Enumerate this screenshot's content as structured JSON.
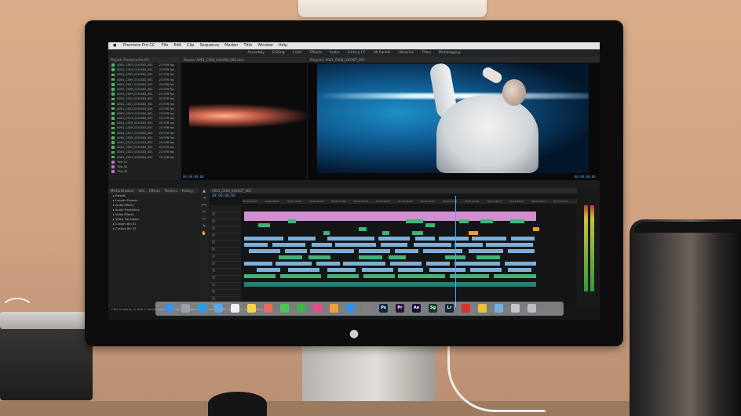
{
  "menubar": {
    "app_title": "Premiere Pro CC",
    "items": [
      "File",
      "Edit",
      "Clip",
      "Sequence",
      "Marker",
      "Title",
      "Window",
      "Help"
    ]
  },
  "workspaces": [
    "Assembly",
    "Editing",
    "Color",
    "Effects",
    "Audio",
    "Editing CC",
    "All Panels",
    "Libraries",
    "Titles",
    "Metalogging"
  ],
  "panels": {
    "project_title": "Project: Premiere Pro CC",
    "source_title": "Source: A001_C008_0101DD_001.mov",
    "program_title": "Program: A001_C008_0101DT_001",
    "effects_tabs": [
      "Media Browser",
      "Info",
      "Effects",
      "Markers",
      "History"
    ],
    "timeline_title": "A001_C008_0101DT_001"
  },
  "timecodes": {
    "source": "00;00;00;00",
    "program": "00;00;00;00"
  },
  "project_clips": [
    {
      "name": "A001_C003_0101DD_001",
      "rate": "23.976 fps",
      "color": "green"
    },
    {
      "name": "A001_C004_0101DD_001",
      "rate": "23.976 fps",
      "color": "green"
    },
    {
      "name": "A001_C005_0101DD_001",
      "rate": "23.976 fps",
      "color": "green"
    },
    {
      "name": "A001_C006_0101DD_001",
      "rate": "23.976 fps",
      "color": "green"
    },
    {
      "name": "A001_C007_0101DD_001",
      "rate": "23.976 fps",
      "color": "green"
    },
    {
      "name": "A001_C008_0101DD_001",
      "rate": "23.976 fps",
      "color": "green"
    },
    {
      "name": "A001_C009_0101DD_001",
      "rate": "23.976 fps",
      "color": "green"
    },
    {
      "name": "A001_C010_0101DD_001",
      "rate": "23.976 fps",
      "color": "green"
    },
    {
      "name": "A001_C011_0101DD_001",
      "rate": "23.976 fps",
      "color": "green"
    },
    {
      "name": "A001_C012_0101DD_001",
      "rate": "23.976 fps",
      "color": "green"
    },
    {
      "name": "A001_C013_0101DD_001",
      "rate": "23.976 fps",
      "color": "green"
    },
    {
      "name": "A001_C014_0101DD_001",
      "rate": "23.976 fps",
      "color": "green"
    },
    {
      "name": "A001_C015_0101DD_001",
      "rate": "23.976 fps",
      "color": "green"
    },
    {
      "name": "A001_C016_0101DD_001",
      "rate": "23.976 fps",
      "color": "green"
    },
    {
      "name": "A001_C017_0101DD_001",
      "rate": "23.976 fps",
      "color": "green"
    },
    {
      "name": "A001_C018_0101DD_001",
      "rate": "23.976 fps",
      "color": "green"
    },
    {
      "name": "A001_C019_0101DD_001",
      "rate": "23.976 fps",
      "color": "green"
    },
    {
      "name": "A001_C020_0101DD_001",
      "rate": "23.976 fps",
      "color": "green"
    },
    {
      "name": "A001_C021_0101DD_001",
      "rate": "23.976 fps",
      "color": "green"
    },
    {
      "name": "A001_C022_0101DD_001",
      "rate": "23.976 fps",
      "color": "green"
    },
    {
      "name": "Title 01",
      "rate": "",
      "color": "pink"
    },
    {
      "name": "Title 02",
      "rate": "",
      "color": "pink"
    },
    {
      "name": "Title 03",
      "rate": "",
      "color": "pink"
    }
  ],
  "effects_items": [
    "Presets",
    "Lumetri Presets",
    "Audio Effects",
    "Audio Transitions",
    "Video Effects",
    "Video Transitions",
    "Custom Bin 01",
    "Custom Bin 02"
  ],
  "ruler_marks": [
    "00;00;00;00",
    "00;00;08;00",
    "00;00;16;00",
    "00;00;24;00",
    "00;00;32;00",
    "00;00;40;00",
    "00;00;48;00",
    "00;00;56;00",
    "00;01;04;02",
    "00;01;12;02",
    "00;01;20;02",
    "00;01;28;02",
    "00;01;36;02",
    "00;01;44;02",
    "00;01;52;02"
  ],
  "statusbar": {
    "hint": "Click to select, or click in empty space and drag to marquee select. Use Shift, Alt, and Ctrl for other options."
  },
  "dock_icons": [
    {
      "name": "finder-icon",
      "label": "",
      "color": "#3d8fe0"
    },
    {
      "name": "launchpad-icon",
      "label": "",
      "color": "#9aa0a8"
    },
    {
      "name": "safari-icon",
      "label": "",
      "color": "#2a9be6"
    },
    {
      "name": "mail-icon",
      "label": "",
      "color": "#5aa5e6"
    },
    {
      "name": "calendar-icon",
      "label": "",
      "color": "#f0f0f0"
    },
    {
      "name": "notes-icon",
      "label": "",
      "color": "#f6d44c"
    },
    {
      "name": "photos-icon",
      "label": "",
      "color": "#e86b5a"
    },
    {
      "name": "messages-icon",
      "label": "",
      "color": "#48c857"
    },
    {
      "name": "facetime-icon",
      "label": "",
      "color": "#3cb54a"
    },
    {
      "name": "itunes-icon",
      "label": "",
      "color": "#e64b8c"
    },
    {
      "name": "ibooks-icon",
      "label": "",
      "color": "#f29e38"
    },
    {
      "name": "app-store-icon",
      "label": "",
      "color": "#2e8fe6"
    },
    {
      "name": "system-preferences-icon",
      "label": "",
      "color": "#7f7f7f"
    },
    {
      "name": "photoshop-icon",
      "label": "Ps",
      "color": "#0b2a45"
    },
    {
      "name": "premiere-icon",
      "label": "Pr",
      "color": "#2a0f3d"
    },
    {
      "name": "after-effects-icon",
      "label": "Ae",
      "color": "#1b0d3a"
    },
    {
      "name": "speedgrade-icon",
      "label": "Sg",
      "color": "#0e3a2b"
    },
    {
      "name": "lightroom-icon",
      "label": "Lr",
      "color": "#11263a"
    },
    {
      "name": "creative-cloud-icon",
      "label": "",
      "color": "#d8322e"
    },
    {
      "name": "chrome-icon",
      "label": "",
      "color": "#e6c235"
    },
    {
      "name": "finder-folder-icon",
      "label": "",
      "color": "#6fb1e8"
    },
    {
      "name": "activity-icon",
      "label": "",
      "color": "#c5c5c5"
    },
    {
      "name": "trash-icon",
      "label": "",
      "color": "#bfbfbf"
    }
  ],
  "colors": {
    "accent_blue": "#4ea3ff",
    "clip_green": "#3fb478",
    "clip_blue": "#7db0d8",
    "clip_orange": "#ee9a3c",
    "clip_pink": "#d08fcf"
  }
}
